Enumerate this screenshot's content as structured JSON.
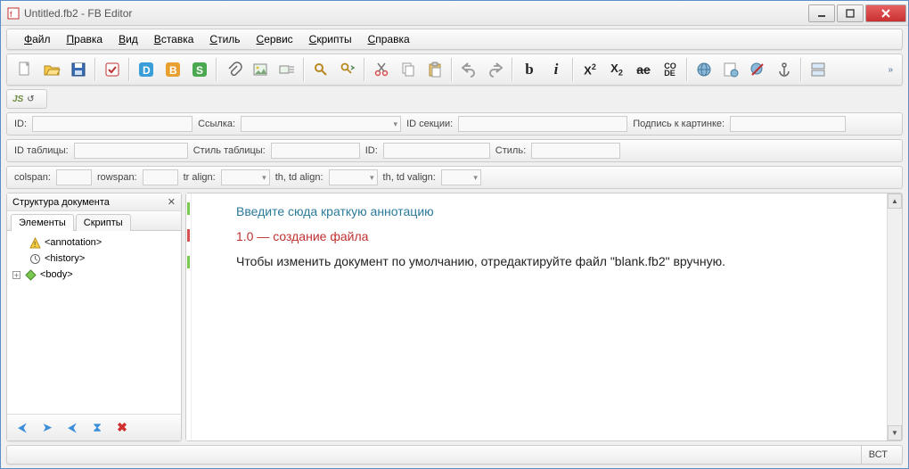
{
  "window": {
    "title": "Untitled.fb2 - FB Editor"
  },
  "menu": [
    "Файл",
    "Правка",
    "Вид",
    "Вставка",
    "Стиль",
    "Сервис",
    "Скрипты",
    "Справка"
  ],
  "toolbar2_label": "JS",
  "fields_row1": {
    "id": "ID:",
    "link": "Ссылка:",
    "section_id": "ID секции:",
    "caption": "Подпись к картинке:"
  },
  "fields_row2": {
    "table_id": "ID таблицы:",
    "table_style": "Стиль таблицы:",
    "id": "ID:",
    "style": "Стиль:"
  },
  "fields_row3": {
    "colspan": "colspan:",
    "rowspan": "rowspan:",
    "tr_align": "tr align:",
    "th_td_align": "th, td align:",
    "th_td_valign": "th, td valign:"
  },
  "side": {
    "header": "Структура документа",
    "tabs": [
      "Элементы",
      "Скрипты"
    ],
    "tree": [
      {
        "icon": "warn",
        "label": "<annotation>",
        "indent": 1
      },
      {
        "icon": "hist",
        "label": "<history>",
        "indent": 1
      },
      {
        "icon": "body",
        "label": "<body>",
        "indent": 1,
        "expand": "+"
      }
    ]
  },
  "editor": {
    "line1": "Введите сюда краткую аннотацию",
    "line2": "1.0 — создание файла",
    "line3": "Чтобы изменить документ по умолчанию, отредактируйте файл \"blank.fb2\" вручную."
  },
  "status": {
    "mode": "ВСТ"
  }
}
